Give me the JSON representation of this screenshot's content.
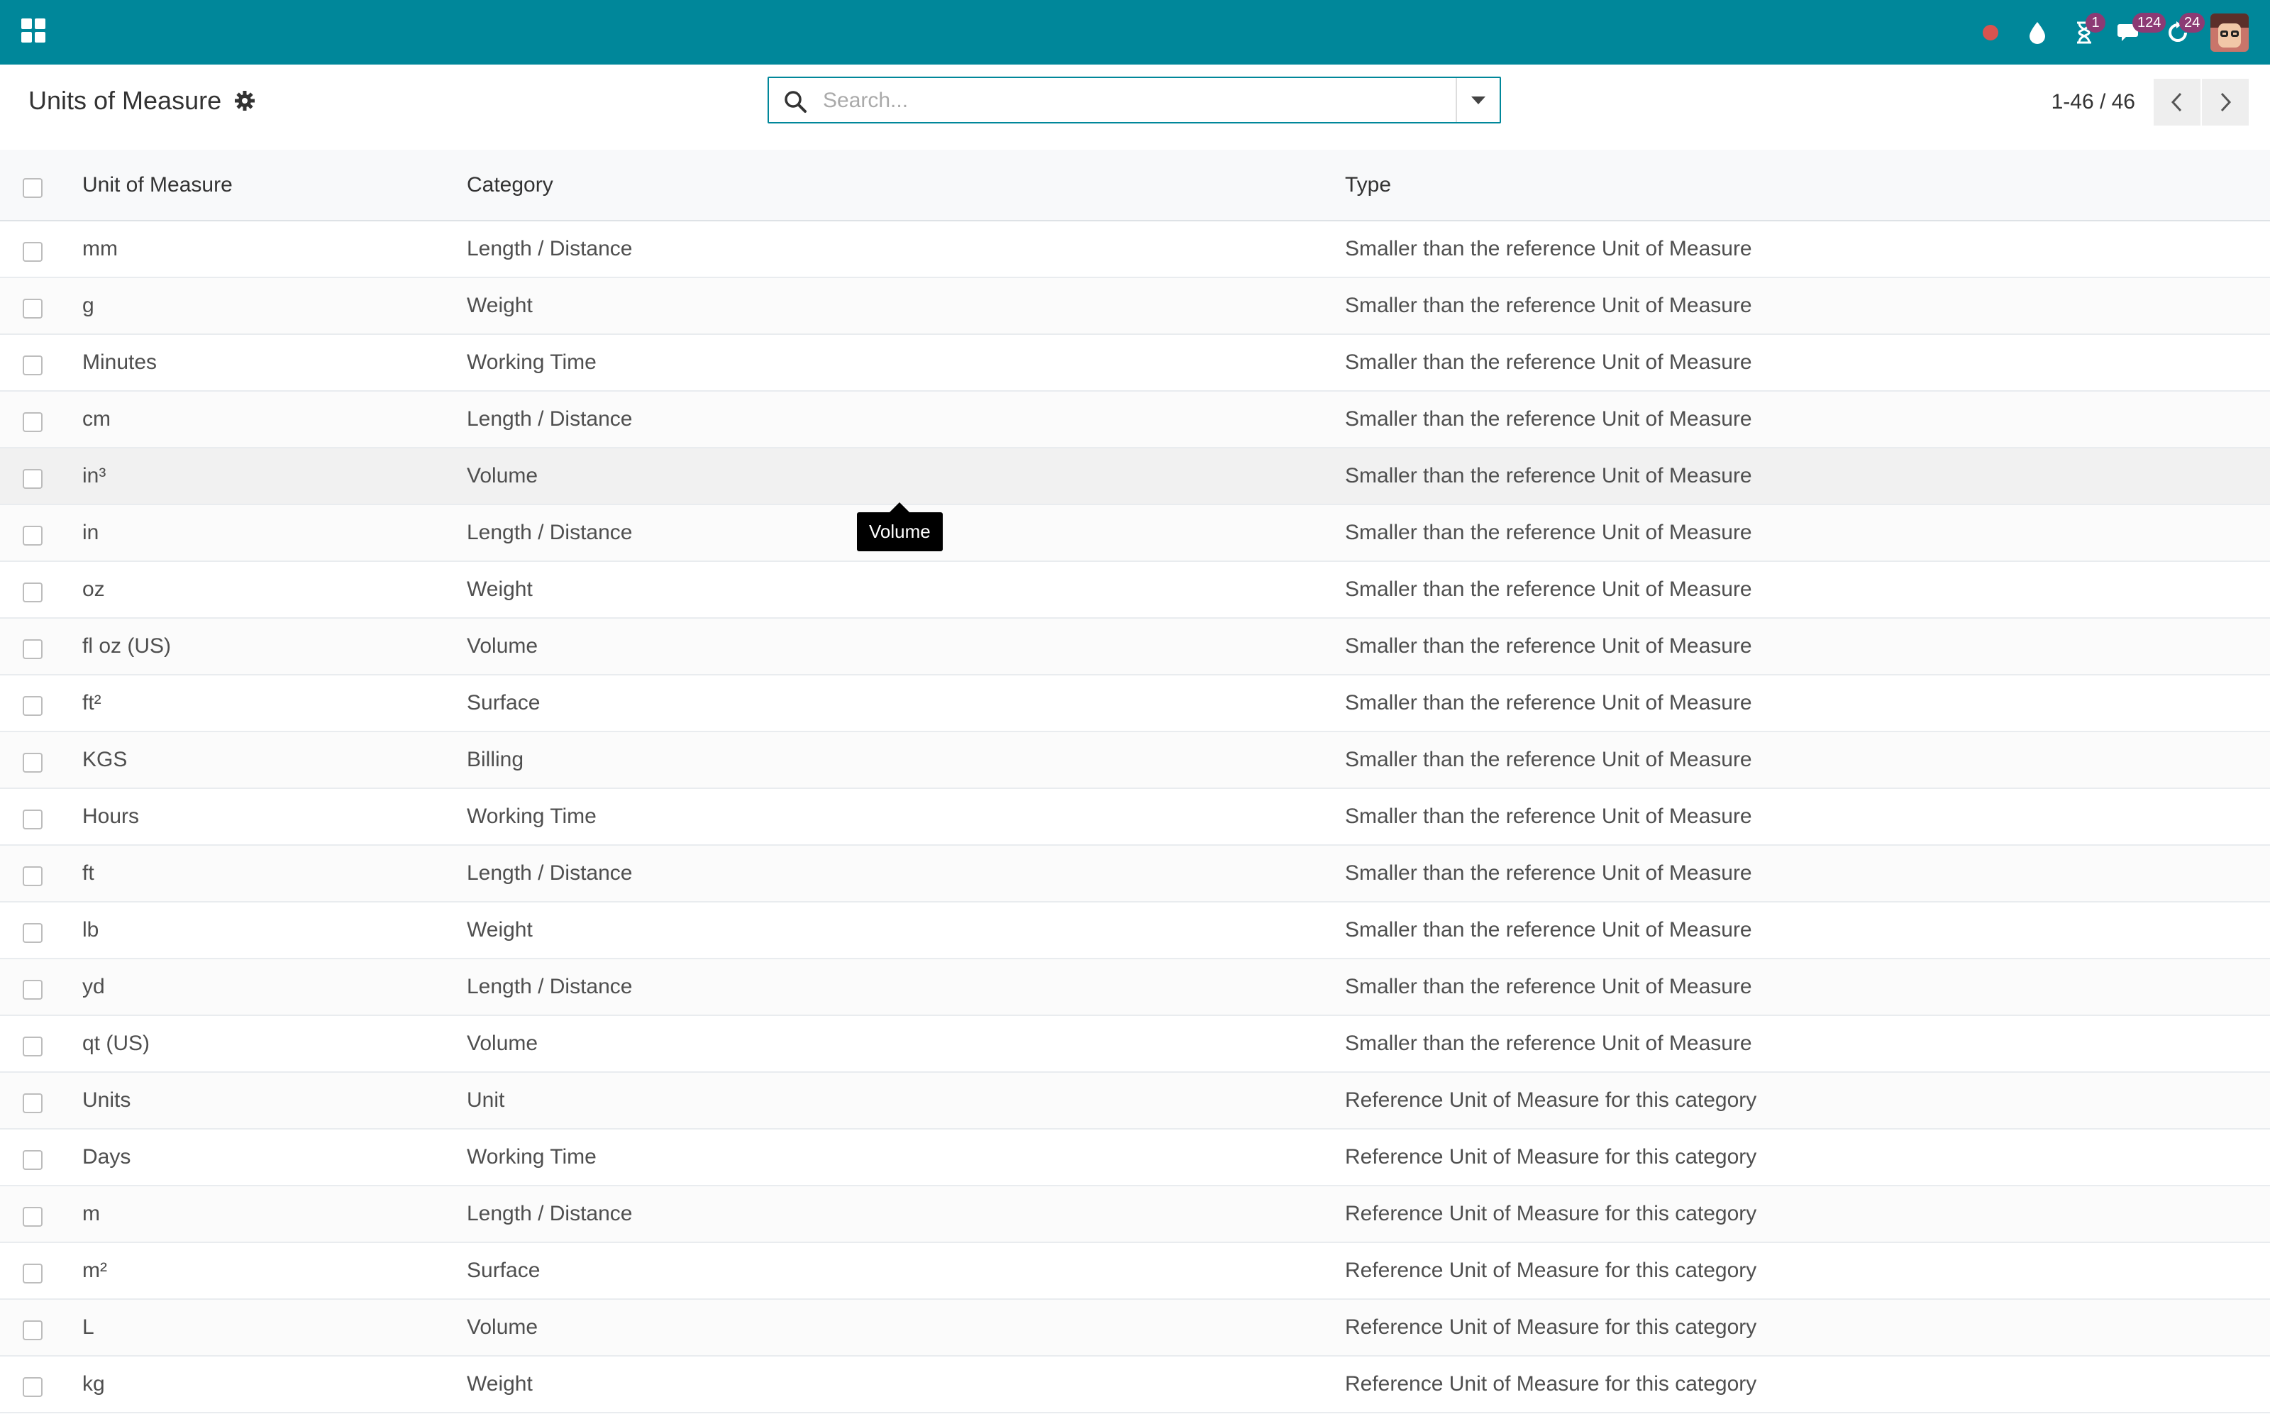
{
  "navbar": {
    "apps_icon": "apps-grid-icon",
    "activity_badge": "1",
    "messages_badge": "124",
    "updates_badge": "24",
    "colors": {
      "bar": "#00879a",
      "badge": "#8c3a74",
      "record": "#d9534f"
    }
  },
  "control_panel": {
    "title": "Units of Measure",
    "search_placeholder": "Search...",
    "pager": "1-46 / 46"
  },
  "table": {
    "headers": {
      "name": "Unit of Measure",
      "category": "Category",
      "type": "Type"
    },
    "rows": [
      {
        "name": "mm",
        "category": "Length / Distance",
        "type": "Smaller than the reference Unit of Measure"
      },
      {
        "name": "g",
        "category": "Weight",
        "type": "Smaller than the reference Unit of Measure"
      },
      {
        "name": "Minutes",
        "category": "Working Time",
        "type": "Smaller than the reference Unit of Measure"
      },
      {
        "name": "cm",
        "category": "Length / Distance",
        "type": "Smaller than the reference Unit of Measure"
      },
      {
        "name": "in³",
        "category": "Volume",
        "type": "Smaller than the reference Unit of Measure"
      },
      {
        "name": "in",
        "category": "Length / Distance",
        "type": "Smaller than the reference Unit of Measure"
      },
      {
        "name": "oz",
        "category": "Weight",
        "type": "Smaller than the reference Unit of Measure"
      },
      {
        "name": "fl oz (US)",
        "category": "Volume",
        "type": "Smaller than the reference Unit of Measure"
      },
      {
        "name": "ft²",
        "category": "Surface",
        "type": "Smaller than the reference Unit of Measure"
      },
      {
        "name": "KGS",
        "category": "Billing",
        "type": "Smaller than the reference Unit of Measure"
      },
      {
        "name": "Hours",
        "category": "Working Time",
        "type": "Smaller than the reference Unit of Measure"
      },
      {
        "name": "ft",
        "category": "Length / Distance",
        "type": "Smaller than the reference Unit of Measure"
      },
      {
        "name": "lb",
        "category": "Weight",
        "type": "Smaller than the reference Unit of Measure"
      },
      {
        "name": "yd",
        "category": "Length / Distance",
        "type": "Smaller than the reference Unit of Measure"
      },
      {
        "name": "qt (US)",
        "category": "Volume",
        "type": "Smaller than the reference Unit of Measure"
      },
      {
        "name": "Units",
        "category": "Unit",
        "type": "Reference Unit of Measure for this category"
      },
      {
        "name": "Days",
        "category": "Working Time",
        "type": "Reference Unit of Measure for this category"
      },
      {
        "name": "m",
        "category": "Length / Distance",
        "type": "Reference Unit of Measure for this category"
      },
      {
        "name": "m²",
        "category": "Surface",
        "type": "Reference Unit of Measure for this category"
      },
      {
        "name": "L",
        "category": "Volume",
        "type": "Reference Unit of Measure for this category"
      },
      {
        "name": "kg",
        "category": "Weight",
        "type": "Reference Unit of Measure for this category"
      }
    ]
  },
  "tooltip": {
    "text": "Volume"
  }
}
